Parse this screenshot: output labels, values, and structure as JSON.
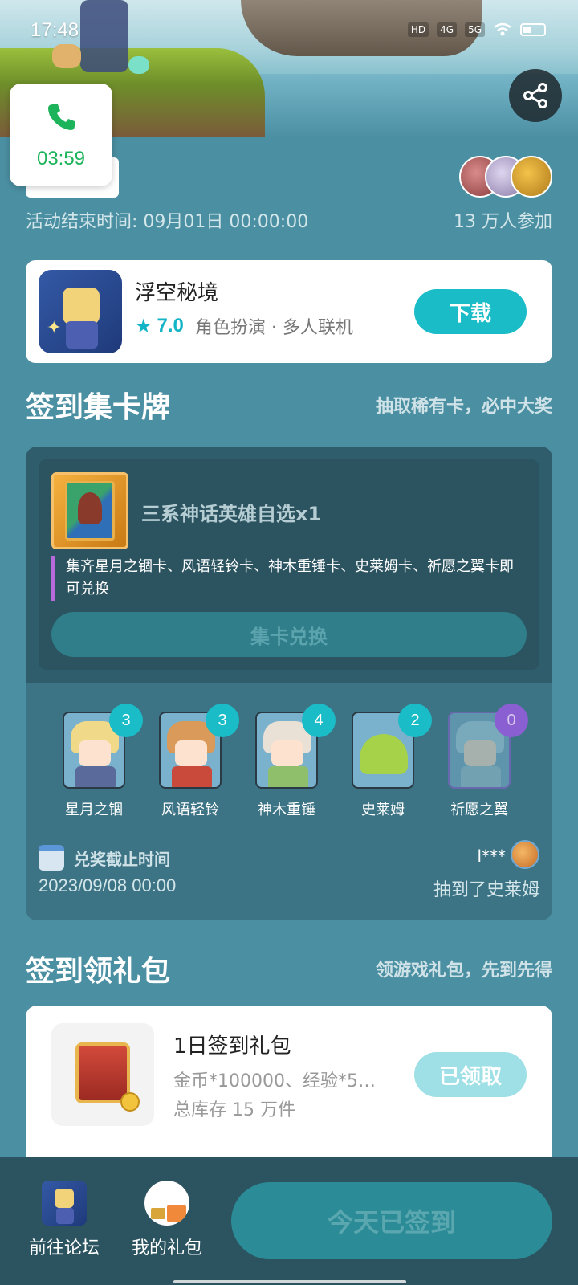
{
  "status_bar": {
    "time": "17:48",
    "indicators": [
      "HD",
      "4G",
      "5G",
      "wifi",
      "battery"
    ]
  },
  "call": {
    "timer": "03:59"
  },
  "activity": {
    "end_time": "活动结束时间: 09月01日 00:00:00",
    "participants": "13 万人参加"
  },
  "game": {
    "title": "浮空秘境",
    "rating": "7.0",
    "genre": "角色扮演 · 多人联机",
    "download_label": "下载"
  },
  "collect_section": {
    "title": "签到集卡牌",
    "subtitle": "抽取稀有卡，必中大奖",
    "reward_title": "三系神话英雄自选x1",
    "reward_desc": "集齐星月之锢卡、风语轻铃卡、神木重锤卡、史莱姆卡、祈愿之翼卡即可兑换",
    "exchange_label": "集卡兑换",
    "cards": [
      {
        "name": "星月之锢",
        "count": "3"
      },
      {
        "name": "风语轻铃",
        "count": "3"
      },
      {
        "name": "神木重锤",
        "count": "4"
      },
      {
        "name": "史莱姆",
        "count": "2"
      },
      {
        "name": "祈愿之翼",
        "count": "0"
      }
    ],
    "deadline_label": "兑奖截止时间",
    "deadline_date": "2023/09/08 00:00",
    "winner_name": "l***",
    "winner_msg": "抽到了史莱姆"
  },
  "gift_section": {
    "title": "签到领礼包",
    "subtitle": "领游戏礼包，先到先得",
    "gift_title": "1日签到礼包",
    "gift_content": "金币*100000、经验*5…",
    "gift_stock": "总库存 15 万件",
    "claimed_label": "已领取"
  },
  "bottom_bar": {
    "forum_label": "前往论坛",
    "my_gift_label": "我的礼包",
    "signed_label": "今天已签到"
  },
  "colors": {
    "background": "#4b8fa2",
    "accent": "#19bcc7",
    "call_green": "#1db35a",
    "panel_dark": "#2b5360"
  }
}
